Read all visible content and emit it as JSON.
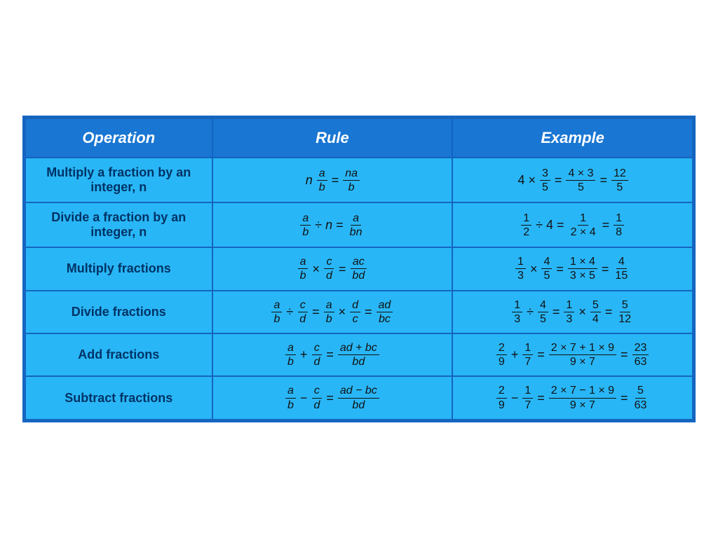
{
  "header": {
    "col1": "Operation",
    "col2": "Rule",
    "col3": "Example"
  },
  "rows": [
    {
      "operation": "Multiply a fraction by an integer, n",
      "rule_html": "multiply_integer_rule",
      "example_html": "multiply_integer_example"
    },
    {
      "operation": "Divide a fraction by an integer, n",
      "rule_html": "divide_integer_rule",
      "example_html": "divide_integer_example"
    },
    {
      "operation": "Multiply fractions",
      "rule_html": "multiply_fractions_rule",
      "example_html": "multiply_fractions_example"
    },
    {
      "operation": "Divide fractions",
      "rule_html": "divide_fractions_rule",
      "example_html": "divide_fractions_example"
    },
    {
      "operation": "Add fractions",
      "rule_html": "add_fractions_rule",
      "example_html": "add_fractions_example"
    },
    {
      "operation": "Subtract fractions",
      "rule_html": "subtract_fractions_rule",
      "example_html": "subtract_fractions_example"
    }
  ]
}
